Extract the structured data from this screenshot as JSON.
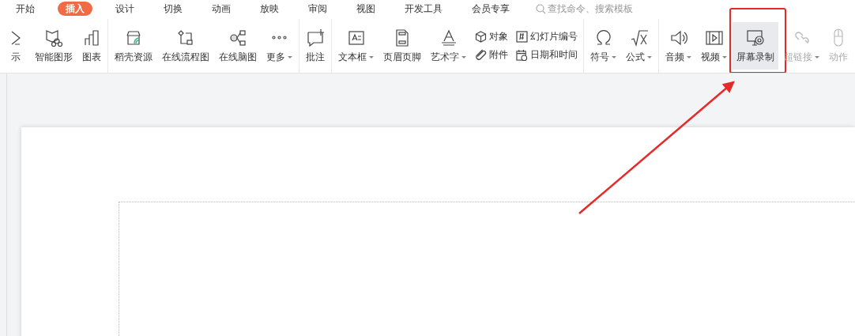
{
  "tabs": [
    {
      "label": "开始",
      "selected": false
    },
    {
      "label": "插入",
      "selected": true
    },
    {
      "label": "设计",
      "selected": false
    },
    {
      "label": "切换",
      "selected": false
    },
    {
      "label": "动画",
      "selected": false
    },
    {
      "label": "放映",
      "selected": false
    },
    {
      "label": "审阅",
      "selected": false
    },
    {
      "label": "视图",
      "selected": false
    },
    {
      "label": "开发工具",
      "selected": false
    },
    {
      "label": "会员专享",
      "selected": false
    }
  ],
  "search": {
    "placeholder": "查找命令、搜索模板"
  },
  "toolbar": [
    [
      {
        "kind": "large",
        "label": "示",
        "caret": false,
        "disabled": false,
        "highlighted": false
      },
      {
        "kind": "large",
        "label": "智能图形",
        "caret": false,
        "disabled": false,
        "highlighted": false
      },
      {
        "kind": "large",
        "label": "图表",
        "caret": false,
        "disabled": false,
        "highlighted": false
      }
    ],
    [
      {
        "kind": "large",
        "label": "稻壳资源",
        "caret": false,
        "disabled": false,
        "highlighted": false
      },
      {
        "kind": "large",
        "label": "在线流程图",
        "caret": false,
        "disabled": false,
        "highlighted": false
      },
      {
        "kind": "large",
        "label": "在线脑图",
        "caret": false,
        "disabled": false,
        "highlighted": false
      },
      {
        "kind": "large",
        "label": "更多",
        "caret": true,
        "disabled": false,
        "highlighted": false
      }
    ],
    [
      {
        "kind": "large",
        "label": "批注",
        "caret": false,
        "disabled": false,
        "highlighted": false
      }
    ],
    [
      {
        "kind": "large",
        "label": "文本框",
        "caret": true,
        "disabled": false,
        "highlighted": false
      },
      {
        "kind": "large",
        "label": "页眉页脚",
        "caret": false,
        "disabled": false,
        "highlighted": false
      },
      {
        "kind": "large",
        "label": "艺术字",
        "caret": true,
        "disabled": false,
        "highlighted": false
      },
      {
        "kind": "small",
        "label": "对象",
        "caret": false,
        "disabled": false,
        "highlighted": false
      },
      {
        "kind": "small",
        "label": "附件",
        "caret": false,
        "disabled": false,
        "highlighted": false
      },
      {
        "kind": "small",
        "label": "幻灯片编号",
        "caret": false,
        "disabled": false,
        "highlighted": false
      },
      {
        "kind": "small",
        "label": "日期和时间",
        "caret": false,
        "disabled": false,
        "highlighted": false
      }
    ],
    [
      {
        "kind": "large",
        "label": "符号",
        "caret": true,
        "disabled": false,
        "highlighted": false
      },
      {
        "kind": "large",
        "label": "公式",
        "caret": true,
        "disabled": false,
        "highlighted": false
      }
    ],
    [
      {
        "kind": "large",
        "label": "音频",
        "caret": true,
        "disabled": false,
        "highlighted": false
      },
      {
        "kind": "large",
        "label": "视频",
        "caret": true,
        "disabled": false,
        "highlighted": false
      },
      {
        "kind": "large",
        "label": "屏幕录制",
        "caret": false,
        "disabled": false,
        "highlighted": true,
        "annotated": true
      },
      {
        "kind": "large",
        "label": "超链接",
        "caret": true,
        "disabled": true,
        "highlighted": false
      },
      {
        "kind": "large",
        "label": "动作",
        "caret": false,
        "disabled": true,
        "highlighted": false
      }
    ]
  ]
}
